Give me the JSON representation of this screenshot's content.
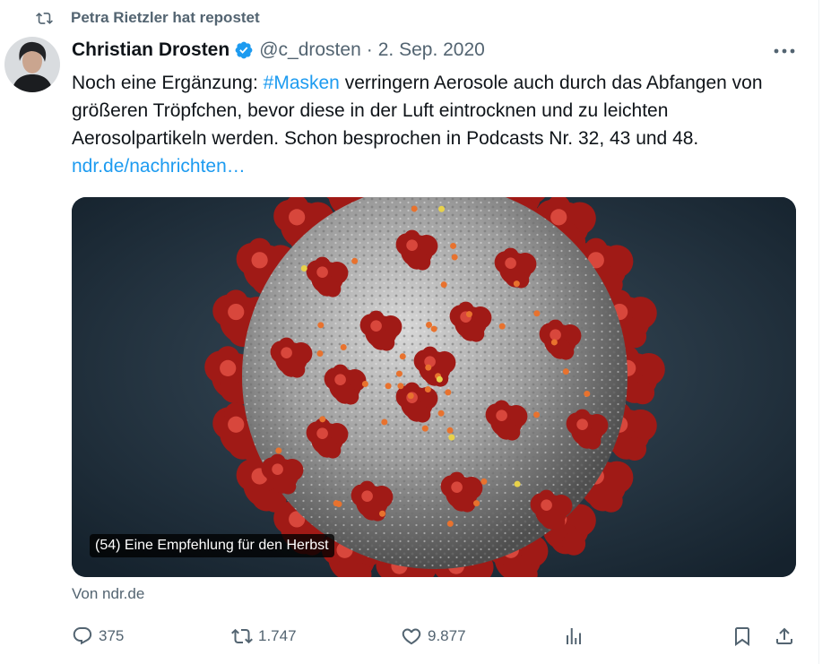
{
  "repost": {
    "text": "Petra Rietzler hat repostet",
    "icon": "repost-icon"
  },
  "author": {
    "name": "Christian Drosten",
    "handle": "@c_drosten",
    "separator": "·",
    "date": "2. Sep. 2020",
    "verified_color": "#1d9bf0"
  },
  "tweet": {
    "text_before": "Noch eine Ergänzung: ",
    "hashtag": "#Masken",
    "text_after": " verringern Aerosole auch durch das Abfangen von größeren Tröpfchen, bevor diese in der Luft eintrocknen und zu leichten Aerosolpartikeln werden. Schon besprochen in Podcasts Nr. 32, 43 und 48. ",
    "link": "ndr.de/nachrichten…"
  },
  "media": {
    "caption": "(54) Eine Empfehlung für den Herbst",
    "source": "Von ndr.de"
  },
  "actions": {
    "replies": "375",
    "reposts": "1.747",
    "likes": "9.877"
  },
  "colors": {
    "link": "#1d9bf0",
    "muted": "#536471",
    "text": "#0f1419"
  }
}
